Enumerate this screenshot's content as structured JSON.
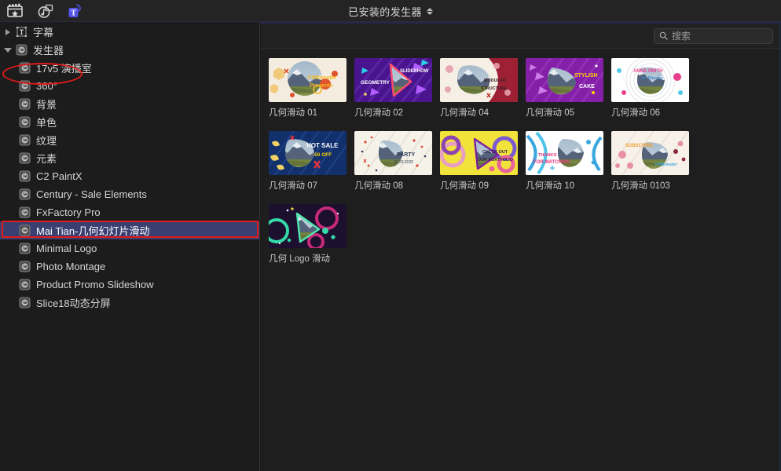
{
  "toolbar": {
    "icons": [
      {
        "name": "titles-generators-icon",
        "label": "Titles and Generators"
      },
      {
        "name": "music-sound-icon",
        "label": "Music and Sound"
      },
      {
        "name": "text-titles-icon",
        "label": "Titles",
        "active": true
      }
    ],
    "title": "已安装的发生器",
    "chevron": "sort-chevron-updown"
  },
  "search": {
    "placeholder": "搜索",
    "value": "",
    "icon": "search-icon"
  },
  "sidebar": {
    "items": [
      {
        "label": "字幕",
        "level": 0,
        "expanded": false,
        "icon": "titles-frame-icon",
        "selected": false
      },
      {
        "label": "发生器",
        "level": 0,
        "expanded": true,
        "icon": "generator-icon",
        "selected": false,
        "annotated": true
      },
      {
        "label": "17v5 演播室",
        "level": 1,
        "icon": "generator-icon",
        "selected": false
      },
      {
        "label": "360°",
        "level": 1,
        "icon": "generator-icon",
        "selected": false
      },
      {
        "label": "背景",
        "level": 1,
        "icon": "generator-icon",
        "selected": false
      },
      {
        "label": "单色",
        "level": 1,
        "icon": "generator-icon",
        "selected": false
      },
      {
        "label": "纹理",
        "level": 1,
        "icon": "generator-icon",
        "selected": false
      },
      {
        "label": "元素",
        "level": 1,
        "icon": "generator-icon",
        "selected": false
      },
      {
        "label": "C2 PaintX",
        "level": 1,
        "icon": "generator-icon",
        "selected": false
      },
      {
        "label": "Century - Sale Elements",
        "level": 1,
        "icon": "generator-icon",
        "selected": false
      },
      {
        "label": "FxFactory Pro",
        "level": 1,
        "icon": "generator-icon",
        "selected": false
      },
      {
        "label": "Mai Tian-几何幻灯片滑动",
        "level": 1,
        "icon": "generator-icon",
        "selected": true,
        "annotated": true
      },
      {
        "label": "Minimal Logo",
        "level": 1,
        "icon": "generator-icon",
        "selected": false
      },
      {
        "label": "Photo Montage",
        "level": 1,
        "icon": "generator-icon",
        "selected": false
      },
      {
        "label": "Product Promo Slideshow",
        "level": 1,
        "icon": "generator-icon",
        "selected": false
      },
      {
        "label": "Slice18动态分屏",
        "level": 1,
        "icon": "generator-icon",
        "selected": false
      }
    ]
  },
  "browser": {
    "items": [
      {
        "label": "几何滑动 01",
        "thumb": "t01",
        "overlay": "FXMonster Presents"
      },
      {
        "label": "几何滑动 02",
        "thumb": "t02",
        "overlay": "SLIDESHOW GEOMETRY"
      },
      {
        "label": "几何滑动 04",
        "thumb": "t04",
        "overlay": "MODULAR STRUCTURE"
      },
      {
        "label": "几何滑动 05",
        "thumb": "t05",
        "overlay": "STYLISH CAKE"
      },
      {
        "label": "几何滑动 06",
        "thumb": "t06",
        "overlay": "ANNA SMITH Art Director"
      },
      {
        "label": "几何滑动 07",
        "thumb": "t07",
        "overlay": "HOT SALE -50 OFF"
      },
      {
        "label": "几何滑动 08",
        "thumb": "t08",
        "overlay": "PARTY 09.23.2020"
      },
      {
        "label": "几何滑动 09",
        "thumb": "t09",
        "overlay": "CHECK OUT OUR PORTFOLIO"
      },
      {
        "label": "几何滑动 10",
        "thumb": "t10",
        "overlay": "THANKS FOR WATCHING"
      },
      {
        "label": "几何滑动 0103",
        "thumb": "t0103",
        "overlay": "SUBSCRIBE FXMonster"
      },
      {
        "label": "几何 Logo 滑动",
        "thumb": "tlogo",
        "overlay": ""
      }
    ]
  },
  "colors": {
    "window_bg": "#1c1c1c",
    "toolbar_bg": "#242424",
    "selection_blue": "#3a3f72",
    "annotation_red": "#e01b1b",
    "accent_blue": "#5352e8",
    "text_primary": "#d6d6d6",
    "text_muted": "#9b9b9b"
  }
}
